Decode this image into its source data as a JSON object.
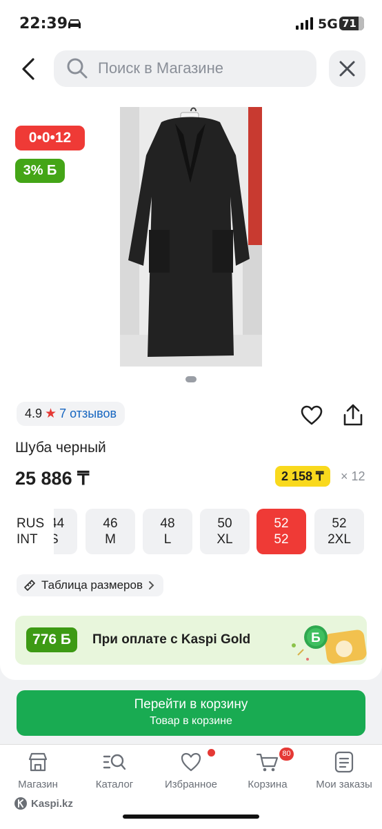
{
  "status_bar": {
    "time": "22:39",
    "network": "5G",
    "battery": "71"
  },
  "search": {
    "placeholder": "Поиск в Магазине"
  },
  "product": {
    "installment_badge": "0•0•12",
    "bonus_badge": "3% Б",
    "rating": "4.9",
    "reviews": "7 отзывов",
    "title": "Шуба черный",
    "price": "25 886 ₸",
    "monthly_price": "2 158 ₸",
    "months": "× 12"
  },
  "sizes": {
    "row_labels": [
      "RUS",
      "INT"
    ],
    "options": [
      {
        "rus": "44",
        "int": "S",
        "partial": true
      },
      {
        "rus": "46",
        "int": "M"
      },
      {
        "rus": "48",
        "int": "L"
      },
      {
        "rus": "50",
        "int": "XL"
      },
      {
        "rus": "52",
        "int": "52",
        "selected": true
      },
      {
        "rus": "52",
        "int": "2XL"
      }
    ],
    "chart_link": "Таблица размеров"
  },
  "kaspi_gold": {
    "bonus": "776 Б",
    "text": "При оплате с Kaspi Gold"
  },
  "cart_button": {
    "line1": "Перейти в корзину",
    "line2": "Товар в корзине"
  },
  "bottom_nav": {
    "items": [
      "Магазин",
      "Каталог",
      "Избранное",
      "Корзина",
      "Мои заказы"
    ],
    "cart_count": "80"
  },
  "watermark": "Kaspi.kz",
  "colors": {
    "accent_red": "#ef3a36",
    "kaspi_green": "#19ab52",
    "credit_yellow": "#f9d91d",
    "link_blue": "#1565c0"
  }
}
